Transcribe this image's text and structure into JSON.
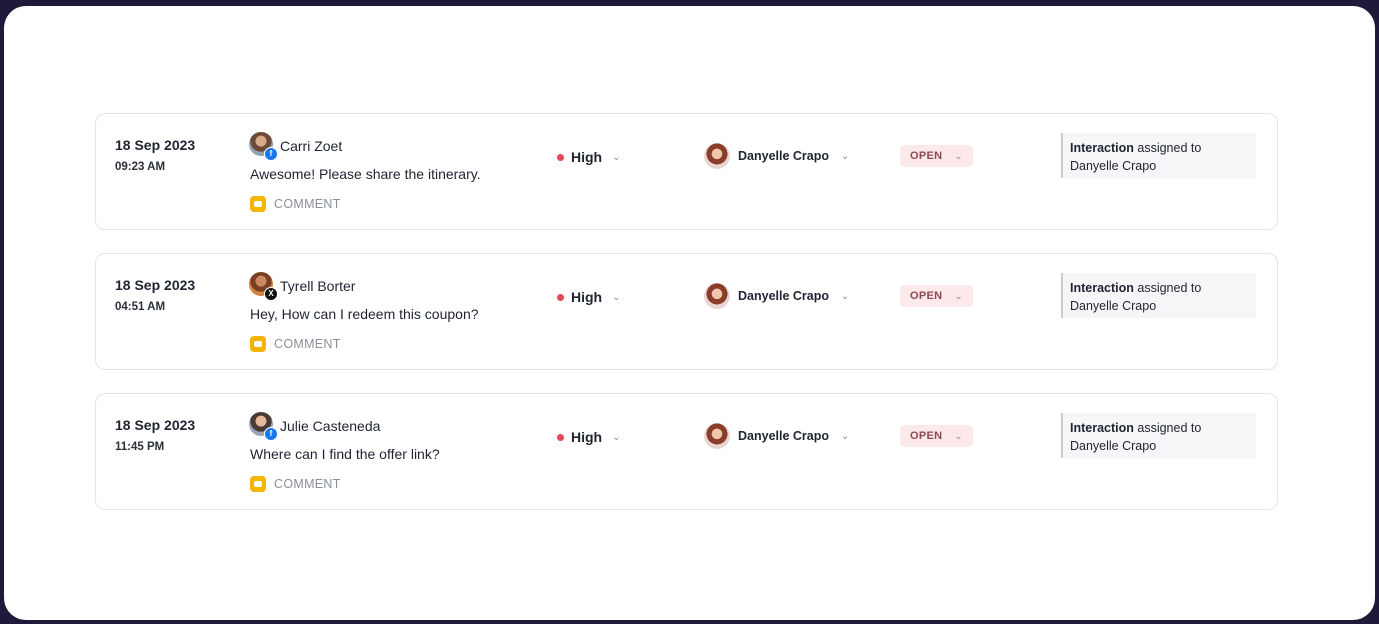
{
  "interactions": [
    {
      "date": "18 Sep 2023",
      "time": "09:23 AM",
      "customer": "Carri Zoet",
      "network": "facebook",
      "message": "Awesome! Please share the itinerary.",
      "type_label": "COMMENT",
      "priority": "High",
      "assignee": "Danyelle Crapo",
      "status": "OPEN",
      "activity_bold": "Interaction",
      "activity_rest": " assigned to",
      "activity_target": "Danyelle Crapo"
    },
    {
      "date": "18 Sep 2023",
      "time": "04:51 AM",
      "customer": "Tyrell Borter",
      "network": "x",
      "message": "Hey, How can I redeem this coupon?",
      "type_label": "COMMENT",
      "priority": "High",
      "assignee": "Danyelle Crapo",
      "status": "OPEN",
      "activity_bold": "Interaction",
      "activity_rest": " assigned to",
      "activity_target": "Danyelle Crapo"
    },
    {
      "date": "18 Sep 2023",
      "time": "11:45 PM",
      "customer": "Julie Casteneda",
      "network": "facebook",
      "message": "Where can I find the offer link?",
      "type_label": "COMMENT",
      "priority": "High",
      "assignee": "Danyelle Crapo",
      "status": "OPEN",
      "activity_bold": "Interaction",
      "activity_rest": " assigned to",
      "activity_target": "Danyelle Crapo"
    }
  ],
  "colors": {
    "background": "#1e1b3a",
    "priority_high": "#e2475a",
    "comment_icon": "#f5b400",
    "status_open_bg": "#fde8ea",
    "facebook": "#1877f2"
  }
}
